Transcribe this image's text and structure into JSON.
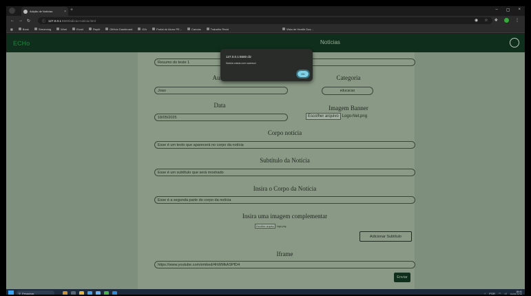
{
  "browser": {
    "tab_title": "Adição de Notícias",
    "tab_close": "×",
    "new_tab": "+",
    "window_controls": [
      "–",
      "▢",
      "×"
    ],
    "url_host": "127.0.0.1",
    "url_path": ":5500/adicao-noticia.html",
    "bookmarks": [
      "Book",
      "Streaming",
      "Wirel",
      "Excel",
      "Replit",
      "GitHub Dashboard",
      "IDA",
      "Portal do Aluno PE...",
      "Canvas",
      "Trabalho Redd",
      "Vista de Health Gus..."
    ]
  },
  "site": {
    "logo": "ECHo",
    "nav_center": "Notícias"
  },
  "alert": {
    "title": "127.0.0.1:5500 diz",
    "message": "Notícia criada com sucesso!",
    "ok": "OK"
  },
  "form": {
    "resumo_value": "Resumo do teste 1",
    "autor_label": "Autor",
    "autor_value": "Joao",
    "categoria_label": "Categoria",
    "categoria_value": "educacao",
    "data_label": "Data",
    "data_value": "18/05/2025",
    "banner_label": "Imagem Banner",
    "banner_button": "Escolher arquivo",
    "banner_file": "Logo-Net.png",
    "corpo_label": "Corpo notícia",
    "corpo_value": "Esse é um texto que aparecerá no corpo da notícia",
    "subtitulo_label": "Subtítulo da Notícia",
    "subtitulo_value": "Esse é um subtítulo que será mostrado",
    "corpo2_label": "Insira o Corpo da Notícia",
    "corpo2_value": "Esse é a segunda parte do corpo da notícia",
    "imgcomp_label": "Insira uma imagem complementar",
    "imgcomp_button": "Escolher arquivo",
    "imgcomp_file": "logo.png",
    "add_subtitle": "Adicionar Subtítulo",
    "iframe_label": "Iframe",
    "iframe_value": "https://www.youtube.com/embed/4hWMkASPfD4",
    "send": "Enviar"
  },
  "taskbar": {
    "search": "Pesquisar",
    "time": "18:41",
    "date": "18/05/2025",
    "lang": "POR"
  }
}
